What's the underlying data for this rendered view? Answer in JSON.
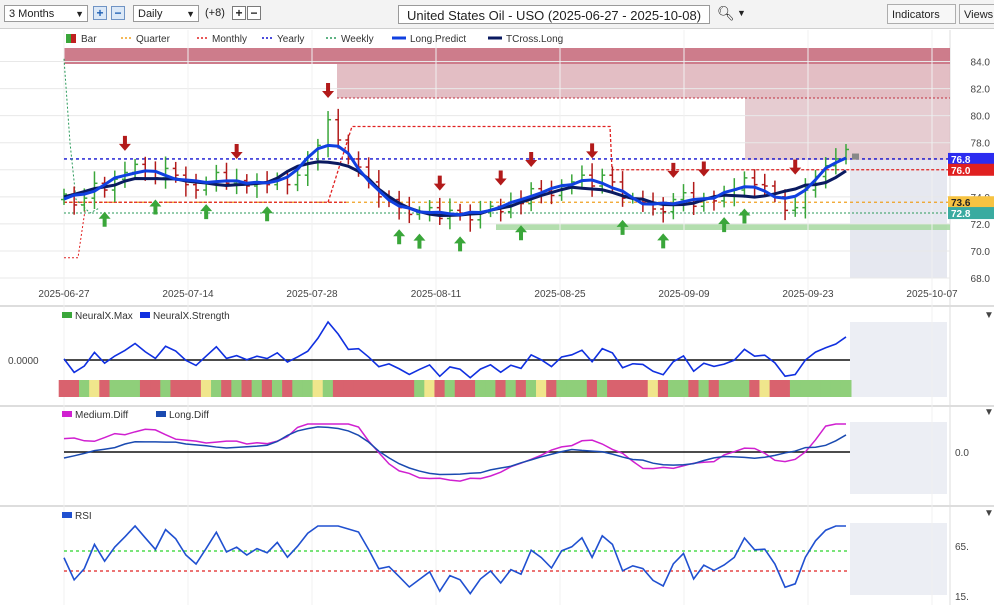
{
  "toolbar": {
    "range": "3 Months",
    "interval": "Daily",
    "offset": "(+8)",
    "title": "United States Oil - USO (2025-06-27 - 2025-10-08)",
    "indicators_label": "Indicators",
    "views_label": "Views"
  },
  "legend_main": [
    "Bar",
    "Quarter",
    "Monthly",
    "Yearly",
    "Weekly",
    "Long.Predict",
    "TCross.Long"
  ],
  "legend_p2": [
    "NeuralX.Max",
    "NeuralX.Strength"
  ],
  "legend_p3": [
    "Medium.Diff",
    "Long.Diff"
  ],
  "legend_p4": [
    "RSI"
  ],
  "colors": {
    "yearly": "#1010d0",
    "monthly": "#e02020",
    "quarter": "#f0a020",
    "weekly": "#2a9a5a",
    "long_predict": "#1040e0",
    "tcross_long": "#0a1a60",
    "up": "#3aa63a",
    "down": "#b21a1a",
    "medium_diff": "#d020d0",
    "long_diff": "#1a4ab0",
    "rsi": "#2050d0"
  },
  "chart_data": [
    {
      "type": "line",
      "panel": "price",
      "x_tick_labels": [
        "2025-06-27",
        "2025-07-14",
        "2025-07-28",
        "2025-08-11",
        "2025-08-25",
        "2025-09-09",
        "2025-09-23",
        "2025-10-07"
      ],
      "y_tick_labels": [
        "84.0",
        "82.0",
        "80.0",
        "78.0",
        "76.0",
        "74.0",
        "72.0",
        "70.0",
        "68.0"
      ],
      "ylim": [
        68,
        85
      ],
      "price_labels": [
        "76.8",
        "76.0",
        "73.6",
        "72.8"
      ],
      "close": [
        74.2,
        73.4,
        73.9,
        75.0,
        74.5,
        75.3,
        75.8,
        76.4,
        75.9,
        75.4,
        76.1,
        75.6,
        74.9,
        74.5,
        75.1,
        75.8,
        75.0,
        75.2,
        74.8,
        75.1,
        74.9,
        75.4,
        74.9,
        75.6,
        76.5,
        77.8,
        79.7,
        78.2,
        76.8,
        76.2,
        75.1,
        74.0,
        73.8,
        73.2,
        72.7,
        72.9,
        73.2,
        72.4,
        73.0,
        72.8,
        72.3,
        72.9,
        73.3,
        72.9,
        73.6,
        73.5,
        74.6,
        74.4,
        74.1,
        74.9,
        75.1,
        75.6,
        74.8,
        75.6,
        75.1,
        73.9,
        73.9,
        73.6,
        73.1,
        72.9,
        73.8,
        74.3,
        73.3,
        73.9,
        73.7,
        74.1,
        74.5,
        75.4,
        74.9,
        74.8,
        74.0,
        73.0,
        73.2,
        74.5,
        75.5,
        76.3,
        76.8,
        77.5
      ],
      "yearly": 76.8,
      "quarter": 73.6,
      "weekly_level": 72.8
    },
    {
      "type": "line",
      "panel": "neuralx",
      "series": [
        {
          "name": "NeuralX.Strength"
        }
      ],
      "y_tick_labels": [
        "0.0000"
      ]
    },
    {
      "type": "line",
      "panel": "diff",
      "series": [
        {
          "name": "Medium.Diff"
        },
        {
          "name": "Long.Diff"
        }
      ],
      "y_tick_labels": [
        "0.0"
      ]
    },
    {
      "type": "line",
      "panel": "rsi",
      "series": [
        {
          "name": "RSI"
        }
      ],
      "y_tick_labels": [
        "65.",
        "15."
      ]
    }
  ]
}
